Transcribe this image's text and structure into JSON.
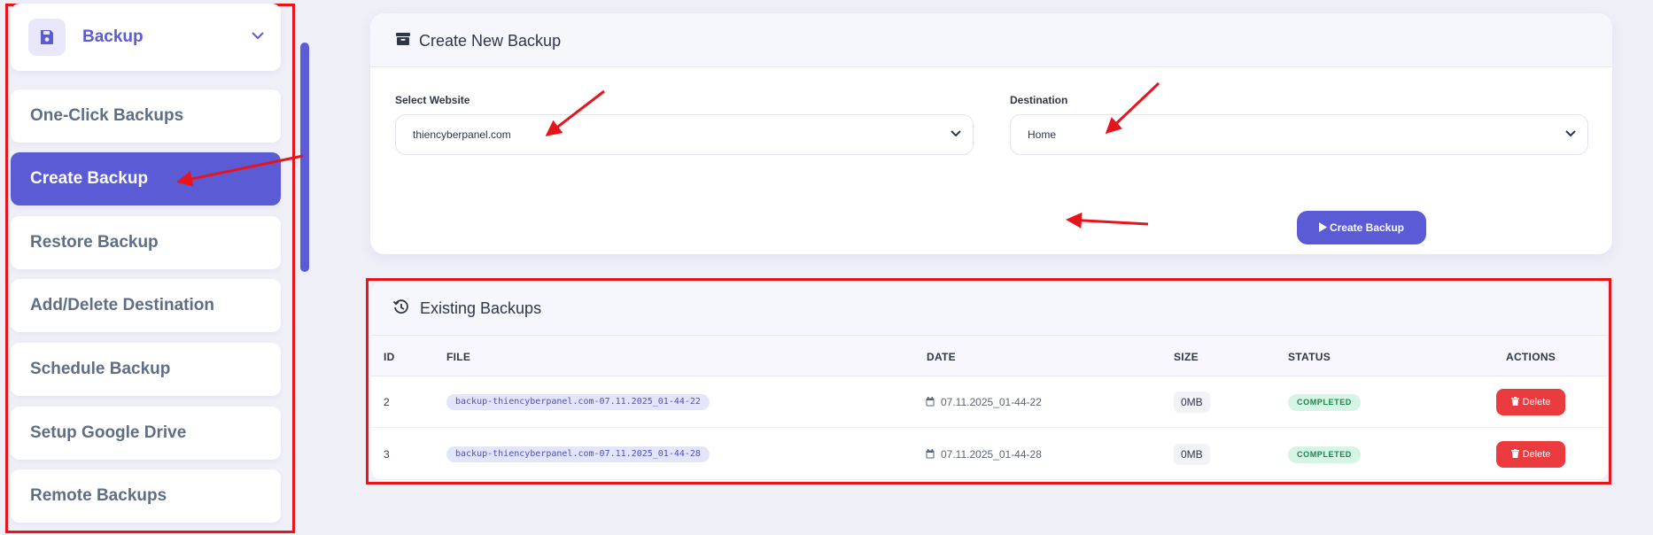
{
  "sidebar": {
    "header": {
      "title": "Backup",
      "icon": "floppy-disk-icon"
    },
    "items": [
      {
        "label": "One-Click Backups",
        "active": false
      },
      {
        "label": "Create Backup",
        "active": true
      },
      {
        "label": "Restore Backup",
        "active": false
      },
      {
        "label": "Add/Delete Destination",
        "active": false
      },
      {
        "label": "Schedule Backup",
        "active": false
      },
      {
        "label": "Setup Google Drive",
        "active": false
      },
      {
        "label": "Remote Backups",
        "active": false
      }
    ]
  },
  "create_card": {
    "title": "Create New Backup",
    "website_label": "Select Website",
    "website_value": "thiencyberpanel.com",
    "destination_label": "Destination",
    "destination_value": "Home",
    "button_label": "Create Backup"
  },
  "existing_card": {
    "title": "Existing Backups",
    "columns": {
      "id": "ID",
      "file": "FILE",
      "date": "DATE",
      "size": "SIZE",
      "status": "STATUS",
      "actions": "ACTIONS"
    },
    "rows": [
      {
        "id": "2",
        "file": "backup-thiencyberpanel.com-07.11.2025_01-44-22",
        "date": "07.11.2025_01-44-22",
        "size": "0MB",
        "status": "COMPLETED",
        "action": "Delete"
      },
      {
        "id": "3",
        "file": "backup-thiencyberpanel.com-07.11.2025_01-44-28",
        "date": "07.11.2025_01-44-28",
        "size": "0MB",
        "status": "COMPLETED",
        "action": "Delete"
      }
    ]
  },
  "colors": {
    "accent": "#5b5bd6",
    "danger": "#ec3b3e",
    "success_bg": "#d6f5e4",
    "annotation": "#e8141b"
  }
}
